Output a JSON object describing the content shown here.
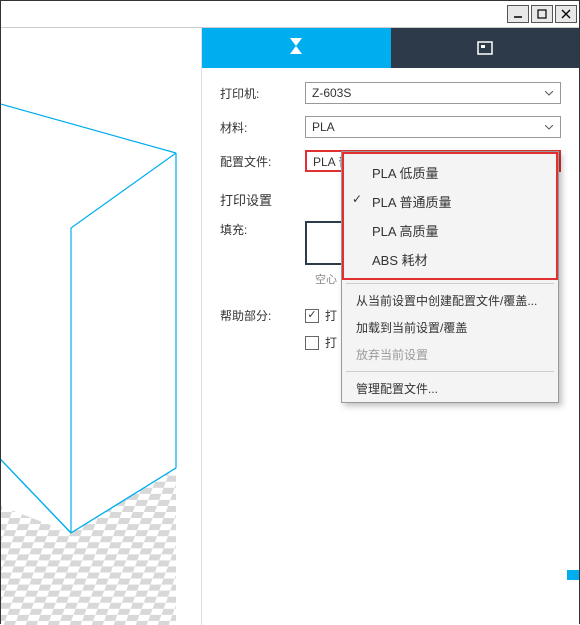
{
  "titlebar": {
    "minimize": "minimize",
    "maximize": "maximize",
    "close": "close"
  },
  "tabs": {
    "print_tab": "print",
    "preview_tab": "preview"
  },
  "form": {
    "printer_label": "打印机:",
    "printer_value": "Z-603S",
    "material_label": "材料:",
    "material_value": "PLA",
    "profile_label": "配置文件:",
    "profile_value": "PLA 普通质量"
  },
  "print_settings_title": "打印设置",
  "fill": {
    "label": "填充:",
    "caption": "空心"
  },
  "help": {
    "label": "帮助部分:",
    "opt1_checked": true,
    "opt1_label": "打",
    "opt2_checked": false,
    "opt2_label": "打"
  },
  "dropdown": {
    "items": [
      {
        "label": "PLA 低质量",
        "checked": false
      },
      {
        "label": "PLA 普通质量",
        "checked": true
      },
      {
        "label": "PLA 高质量",
        "checked": false
      },
      {
        "label": "ABS 耗材",
        "checked": false
      }
    ],
    "create": "从当前设置中创建配置文件/覆盖...",
    "load": "加载到当前设置/覆盖",
    "discard": "放弃当前设置",
    "manage": "管理配置文件..."
  }
}
